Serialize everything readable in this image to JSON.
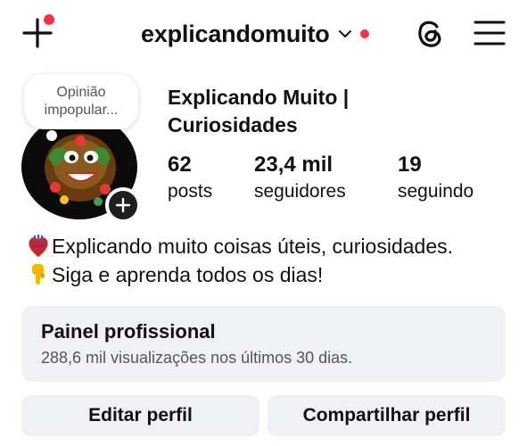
{
  "header": {
    "username": "explicandomuito",
    "notification_color": "#ff3040",
    "icons": [
      "create-icon",
      "chevron-down-icon",
      "threads-icon",
      "menu-icon"
    ]
  },
  "profile": {
    "note": "Opinião impopular...",
    "display_name": "Explicando Muito | Curiosidades",
    "stats": [
      {
        "value": "62",
        "label": "posts"
      },
      {
        "value": "23,4 mil",
        "label": "seguidores"
      },
      {
        "value": "19",
        "label": "seguindo"
      }
    ],
    "bio": [
      {
        "emoji": "anatomical-heart-icon",
        "text": "Explicando muito coisas úteis, curiosidades."
      },
      {
        "emoji": "pointing-down-hand-icon",
        "text": "Siga e aprenda todos os dias!"
      }
    ]
  },
  "dashboard": {
    "title": "Painel profissional",
    "subtitle": "288,6 mil visualizações nos últimos 30 dias."
  },
  "actions": {
    "edit_label": "Editar perfil",
    "share_label": "Compartilhar perfil"
  }
}
